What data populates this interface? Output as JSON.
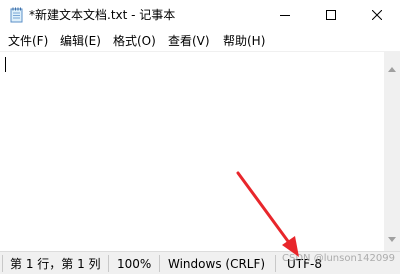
{
  "window": {
    "title": "*新建文本文档.txt - 记事本"
  },
  "menu": {
    "items": [
      "文件(F)",
      "编辑(E)",
      "格式(O)",
      "查看(V)",
      "帮助(H)"
    ]
  },
  "editor": {
    "content": ""
  },
  "status": {
    "position": "第 1 行，第 1 列",
    "zoom": "100%",
    "line_ending": "Windows (CRLF)",
    "encoding": "UTF-8"
  },
  "watermark": "CSDN @lunson142099",
  "annotation": {
    "arrow_color": "#e8262b"
  },
  "icons": {
    "app": "notepad-icon",
    "minimize": "minimize-icon",
    "maximize": "maximize-icon",
    "close": "close-icon"
  }
}
